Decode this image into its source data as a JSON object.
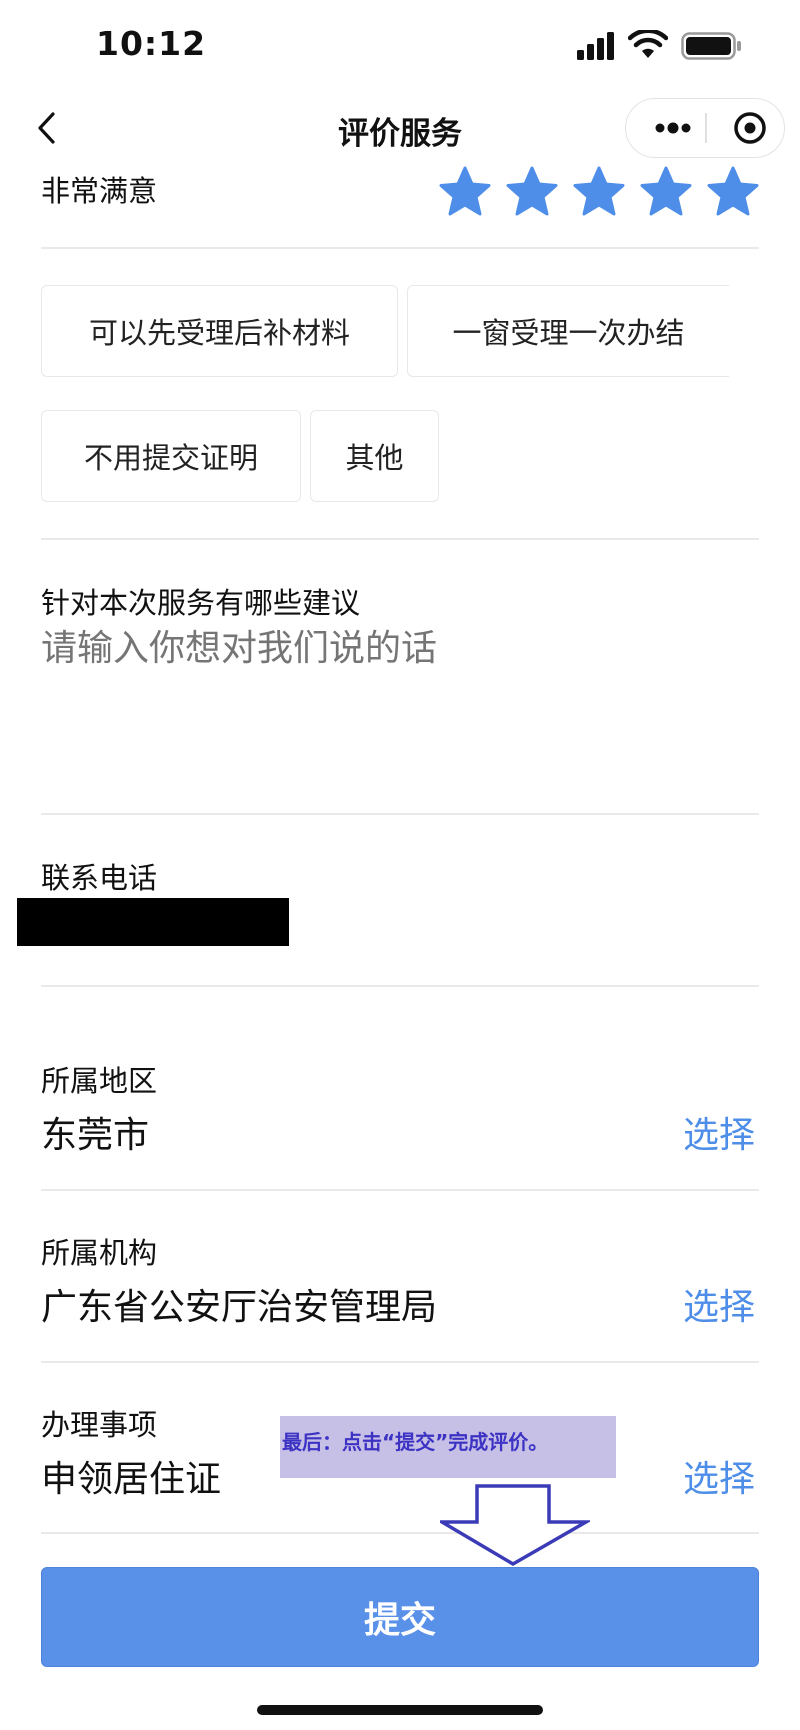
{
  "status_bar": {
    "time": "10:12"
  },
  "nav": {
    "title": "评价服务"
  },
  "rating": {
    "label": "非常满意",
    "stars": 5,
    "max_stars": 5,
    "star_color": "#4f8ee8"
  },
  "tags": [
    "可以先受理后补材料",
    "一窗受理一次办结",
    "不用提交证明",
    "其他"
  ],
  "suggestion": {
    "label": "针对本次服务有哪些建议",
    "placeholder": "请输入你想对我们说的话"
  },
  "phone": {
    "label": "联系电话"
  },
  "region": {
    "label": "所属地区",
    "value": "东莞市",
    "action": "选择"
  },
  "agency": {
    "label": "所属机构",
    "value": "广东省公安厅治安管理局",
    "action": "选择"
  },
  "matter": {
    "label": "办理事项",
    "value": "申领居住证",
    "action": "选择"
  },
  "annotation": {
    "text": "最后：点击“提交”完成评价。"
  },
  "submit": {
    "label": "提交"
  },
  "colors": {
    "accent": "#4f8ee8",
    "button": "#5a91e8",
    "annotation_bg": "#c6bfe6",
    "annotation_text": "#3c33c4"
  }
}
